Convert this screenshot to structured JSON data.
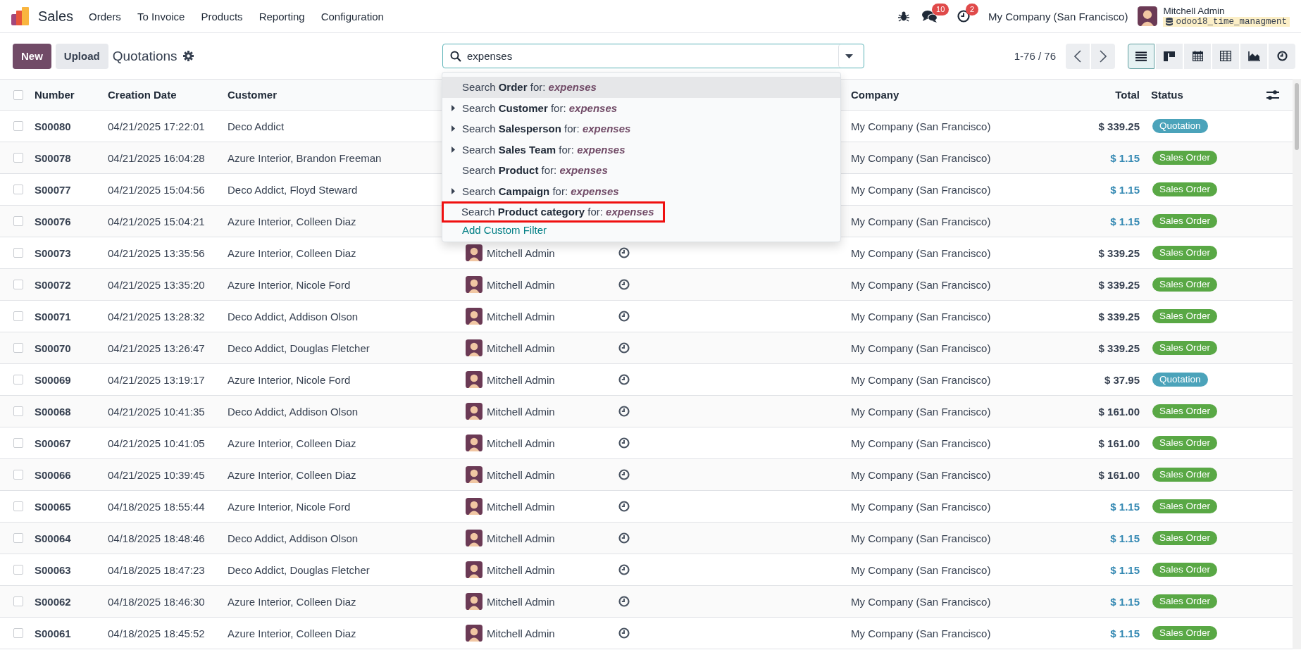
{
  "navbar": {
    "app": "Sales",
    "menu": [
      "Orders",
      "To Invoice",
      "Products",
      "Reporting",
      "Configuration"
    ],
    "messages_badge": "10",
    "activities_badge": "2",
    "company": "My Company (San Francisco)",
    "user": "Mitchell Admin",
    "database": "odoo18_time_managment"
  },
  "control_panel": {
    "buttons": [
      {
        "label": "New",
        "kind": "primary"
      },
      {
        "label": "Upload",
        "kind": "secondary"
      }
    ],
    "title": "Quotations",
    "search": {
      "value": "expenses"
    },
    "pager": "1-76 / 76",
    "views": [
      {
        "kind": "list",
        "selected": true
      },
      {
        "kind": "kanban",
        "selected": false
      },
      {
        "kind": "calendar",
        "selected": false
      },
      {
        "kind": "pivot",
        "selected": false
      },
      {
        "kind": "graph",
        "selected": false
      },
      {
        "kind": "activity",
        "selected": false
      }
    ]
  },
  "search_dropdown": {
    "items": [
      {
        "text": "Search **Order** for: *expenses*",
        "expandable": false,
        "selected": true,
        "outlined": false
      },
      {
        "text": "Search **Customer** for: *expenses*",
        "expandable": true,
        "selected": false,
        "outlined": false
      },
      {
        "text": "Search **Salesperson** for: *expenses*",
        "expandable": true,
        "selected": false,
        "outlined": false
      },
      {
        "text": "Search **Sales Team** for: *expenses*",
        "expandable": true,
        "selected": false,
        "outlined": false
      },
      {
        "text": "Search **Product** for: *expenses*",
        "expandable": false,
        "selected": false,
        "outlined": false
      },
      {
        "text": "Search **Campaign** for: *expenses*",
        "expandable": true,
        "selected": false,
        "outlined": false
      },
      {
        "text": "Search **Product category** for: *expenses*",
        "expandable": false,
        "selected": false,
        "outlined": true
      }
    ],
    "link": "Add Custom Filter"
  },
  "table": {
    "select_all": {
      "checked": false
    },
    "columns": [
      "Number",
      "Creation Date",
      "Customer",
      "Company",
      "Total",
      "Status"
    ],
    "rows": [
      {
        "checked": false,
        "number": "S00080",
        "date": "04/21/2025 17:22:01",
        "customer": "Deco Addict",
        "company": "My Company (San Francisco)",
        "total": {
          "text": "$ 339.25",
          "color": "#374151"
        },
        "status": {
          "label": "Quotation",
          "color": "#4ba3ba"
        }
      },
      {
        "checked": false,
        "number": "S00078",
        "date": "04/21/2025 16:04:28",
        "customer": "Azure Interior, Brandon Freeman",
        "company": "My Company (San Francisco)",
        "total": {
          "text": "$ 1.15",
          "color": "#3589b3"
        },
        "status": {
          "label": "Sales Order",
          "color": "#59a845"
        }
      },
      {
        "checked": false,
        "number": "S00077",
        "date": "04/21/2025 15:04:56",
        "customer": "Deco Addict, Floyd Steward",
        "company": "My Company (San Francisco)",
        "total": {
          "text": "$ 1.15",
          "color": "#3589b3"
        },
        "status": {
          "label": "Sales Order",
          "color": "#59a845"
        }
      },
      {
        "checked": false,
        "number": "S00076",
        "date": "04/21/2025 15:04:21",
        "customer": "Azure Interior, Colleen Diaz",
        "company": "My Company (San Francisco)",
        "total": {
          "text": "$ 1.15",
          "color": "#3589b3"
        },
        "status": {
          "label": "Sales Order",
          "color": "#59a845"
        }
      },
      {
        "checked": false,
        "number": "S00073",
        "date": "04/21/2025 13:35:56",
        "customer": "Azure Interior, Colleen Diaz",
        "salesperson": "Mitchell Admin",
        "company": "My Company (San Francisco)",
        "total": {
          "text": "$ 339.25",
          "color": "#374151"
        },
        "status": {
          "label": "Sales Order",
          "color": "#59a845"
        }
      },
      {
        "checked": false,
        "number": "S00072",
        "date": "04/21/2025 13:35:20",
        "customer": "Azure Interior, Nicole Ford",
        "salesperson": "Mitchell Admin",
        "company": "My Company (San Francisco)",
        "total": {
          "text": "$ 339.25",
          "color": "#374151"
        },
        "status": {
          "label": "Sales Order",
          "color": "#59a845"
        }
      },
      {
        "checked": false,
        "number": "S00071",
        "date": "04/21/2025 13:28:32",
        "customer": "Deco Addict, Addison Olson",
        "salesperson": "Mitchell Admin",
        "company": "My Company (San Francisco)",
        "total": {
          "text": "$ 339.25",
          "color": "#374151"
        },
        "status": {
          "label": "Sales Order",
          "color": "#59a845"
        }
      },
      {
        "checked": false,
        "number": "S00070",
        "date": "04/21/2025 13:26:47",
        "customer": "Deco Addict, Douglas Fletcher",
        "salesperson": "Mitchell Admin",
        "company": "My Company (San Francisco)",
        "total": {
          "text": "$ 339.25",
          "color": "#374151"
        },
        "status": {
          "label": "Sales Order",
          "color": "#59a845"
        }
      },
      {
        "checked": false,
        "number": "S00069",
        "date": "04/21/2025 13:19:17",
        "customer": "Azure Interior, Nicole Ford",
        "salesperson": "Mitchell Admin",
        "company": "My Company (San Francisco)",
        "total": {
          "text": "$ 37.95",
          "color": "#374151"
        },
        "status": {
          "label": "Quotation",
          "color": "#4ba3ba"
        }
      },
      {
        "checked": false,
        "number": "S00068",
        "date": "04/21/2025 10:41:35",
        "customer": "Deco Addict, Addison Olson",
        "salesperson": "Mitchell Admin",
        "company": "My Company (San Francisco)",
        "total": {
          "text": "$ 161.00",
          "color": "#374151"
        },
        "status": {
          "label": "Sales Order",
          "color": "#59a845"
        }
      },
      {
        "checked": false,
        "number": "S00067",
        "date": "04/21/2025 10:41:05",
        "customer": "Azure Interior, Colleen Diaz",
        "salesperson": "Mitchell Admin",
        "company": "My Company (San Francisco)",
        "total": {
          "text": "$ 161.00",
          "color": "#374151"
        },
        "status": {
          "label": "Sales Order",
          "color": "#59a845"
        }
      },
      {
        "checked": false,
        "number": "S00066",
        "date": "04/21/2025 10:39:45",
        "customer": "Azure Interior, Colleen Diaz",
        "salesperson": "Mitchell Admin",
        "company": "My Company (San Francisco)",
        "total": {
          "text": "$ 161.00",
          "color": "#374151"
        },
        "status": {
          "label": "Sales Order",
          "color": "#59a845"
        }
      },
      {
        "checked": false,
        "number": "S00065",
        "date": "04/18/2025 18:55:44",
        "customer": "Azure Interior, Nicole Ford",
        "salesperson": "Mitchell Admin",
        "company": "My Company (San Francisco)",
        "total": {
          "text": "$ 1.15",
          "color": "#3589b3"
        },
        "status": {
          "label": "Sales Order",
          "color": "#59a845"
        }
      },
      {
        "checked": false,
        "number": "S00064",
        "date": "04/18/2025 18:48:46",
        "customer": "Deco Addict, Addison Olson",
        "salesperson": "Mitchell Admin",
        "company": "My Company (San Francisco)",
        "total": {
          "text": "$ 1.15",
          "color": "#3589b3"
        },
        "status": {
          "label": "Sales Order",
          "color": "#59a845"
        }
      },
      {
        "checked": false,
        "number": "S00063",
        "date": "04/18/2025 18:47:23",
        "customer": "Deco Addict, Douglas Fletcher",
        "salesperson": "Mitchell Admin",
        "company": "My Company (San Francisco)",
        "total": {
          "text": "$ 1.15",
          "color": "#3589b3"
        },
        "status": {
          "label": "Sales Order",
          "color": "#59a845"
        }
      },
      {
        "checked": false,
        "number": "S00062",
        "date": "04/18/2025 18:46:30",
        "customer": "Azure Interior, Colleen Diaz",
        "salesperson": "Mitchell Admin",
        "company": "My Company (San Francisco)",
        "total": {
          "text": "$ 1.15",
          "color": "#3589b3"
        },
        "status": {
          "label": "Sales Order",
          "color": "#59a845"
        }
      },
      {
        "checked": false,
        "number": "S00061",
        "date": "04/18/2025 18:45:52",
        "customer": "Azure Interior, Colleen Diaz",
        "salesperson": "Mitchell Admin",
        "company": "My Company (San Francisco)",
        "total": {
          "text": "$ 1.15",
          "color": "#3589b3"
        },
        "status": {
          "label": "Sales Order",
          "color": "#59a845"
        }
      }
    ]
  }
}
